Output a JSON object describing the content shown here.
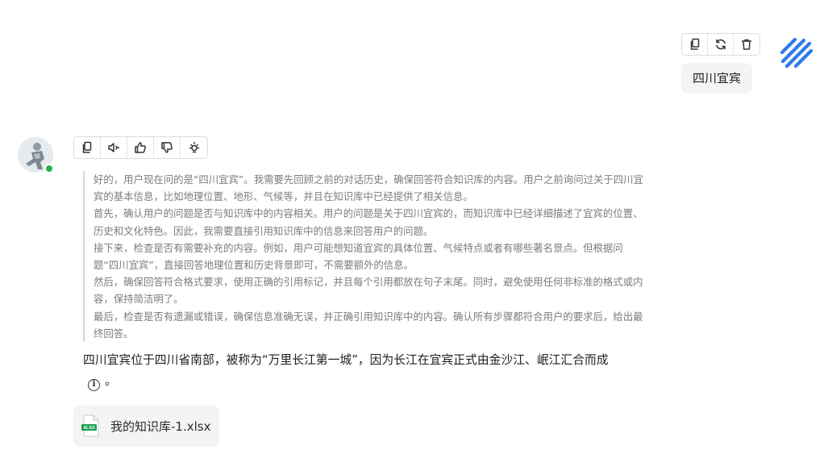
{
  "user_message": {
    "text": "四川宜宾",
    "actions": [
      {
        "name": "copy-icon"
      },
      {
        "name": "refresh-icon"
      },
      {
        "name": "trash-icon"
      }
    ]
  },
  "assistant": {
    "actions": [
      {
        "name": "copy-icon"
      },
      {
        "name": "speaker-icon"
      },
      {
        "name": "thumbs-up-icon"
      },
      {
        "name": "thumbs-down-icon"
      },
      {
        "name": "lightbulb-icon"
      }
    ],
    "thinking": [
      "好的，用户现在问的是“四川宜宾”。我需要先回顾之前的对话历史，确保回答符合知识库的内容。用户之前询问过关于四川宜宾的基本信息，比如地理位置、地形、气候等，并且在知识库中已经提供了相关信息。",
      "首先，确认用户的问题是否与知识库中的内容相关。用户的问题是关于四川宜宾的，而知识库中已经详细描述了宜宾的位置、历史和文化特色。因此，我需要直接引用知识库中的信息来回答用户的问题。",
      "接下来，检查是否有需要补充的内容。例如，用户可能想知道宜宾的具体位置、气候特点或者有哪些著名景点。但根据问题“四川宜宾”，直接回答地理位置和历史背景即可，不需要额外的信息。",
      "然后，确保回答符合格式要求，使用正确的引用标记，并且每个引用都放在句子末尾。同时，避免使用任何非标准的格式或内容，保持简洁明了。",
      "最后，检查是否有遗漏或错误，确保信息准确无误，并正确引用知识库中的内容。确认所有步骤都符合用户的要求后，给出最终回答。"
    ],
    "answer_text": "四川宜宾位于四川省南部，被称为“万里长江第一城”，因为长江在宜宾正式由金沙江、岷江汇合而成",
    "answer_suffix": "。",
    "file": {
      "name": "我的知识库-1.xlsx",
      "badge": "XLSX",
      "badge_color": "#1a9e52"
    }
  },
  "colors": {
    "accent": "#2f7be8",
    "online": "#22b04f",
    "bubble_bg": "#f3f4f6"
  }
}
